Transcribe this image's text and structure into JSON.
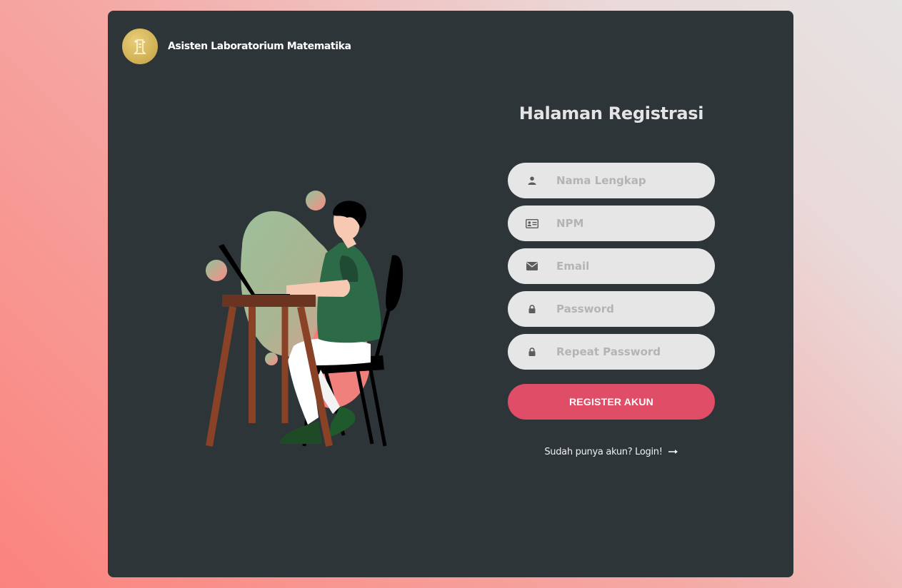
{
  "brand": {
    "name": "Asisten Laboratorium Matematika",
    "logo_icon": "lab-logo-icon"
  },
  "form": {
    "title": "Halaman Registrasi",
    "fields": [
      {
        "placeholder": "Nama Lengkap",
        "icon": "user-icon"
      },
      {
        "placeholder": "NPM",
        "icon": "id-card-icon"
      },
      {
        "placeholder": "Email",
        "icon": "envelope-icon"
      },
      {
        "placeholder": "Password",
        "icon": "lock-icon"
      },
      {
        "placeholder": "Repeat Password",
        "icon": "lock-icon"
      }
    ],
    "submit_label": "REGISTER AKUN",
    "login_link": "Sudah punya akun? Login!",
    "login_icon": "arrow-right-icon"
  },
  "colors": {
    "card_bg": "#2d3538",
    "button": "#e04d66",
    "field_bg": "#e6e6e6",
    "logo_gold": "#cfae52"
  }
}
